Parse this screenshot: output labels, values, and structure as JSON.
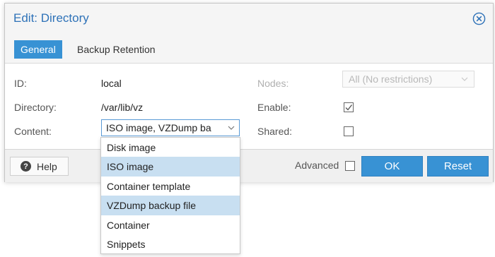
{
  "dialog": {
    "title": "Edit: Directory",
    "close_icon": "close-circle-icon"
  },
  "tabs": [
    {
      "label": "General",
      "active": true
    },
    {
      "label": "Backup Retention",
      "active": false
    }
  ],
  "form": {
    "id_label": "ID:",
    "id_value": "local",
    "directory_label": "Directory:",
    "directory_value": "/var/lib/vz",
    "content_label": "Content:",
    "content_value": "ISO image, VZDump ba",
    "nodes_label": "Nodes:",
    "nodes_placeholder": "All (No restrictions)",
    "enable_label": "Enable:",
    "enable_checked": true,
    "shared_label": "Shared:",
    "shared_checked": false
  },
  "footer": {
    "help_label": "Help",
    "help_icon": "question-circle-icon",
    "advanced_label": "Advanced",
    "advanced_checked": false,
    "ok_label": "OK",
    "reset_label": "Reset"
  },
  "content_dropdown": {
    "options": [
      {
        "label": "Disk image",
        "selected": false
      },
      {
        "label": "ISO image",
        "selected": true
      },
      {
        "label": "Container template",
        "selected": false
      },
      {
        "label": "VZDump backup file",
        "selected": true
      },
      {
        "label": "Container",
        "selected": false
      },
      {
        "label": "Snippets",
        "selected": false
      }
    ]
  },
  "colors": {
    "accent": "#3892d4",
    "title": "#2e72b8",
    "selected_option": "#c8dff1"
  }
}
